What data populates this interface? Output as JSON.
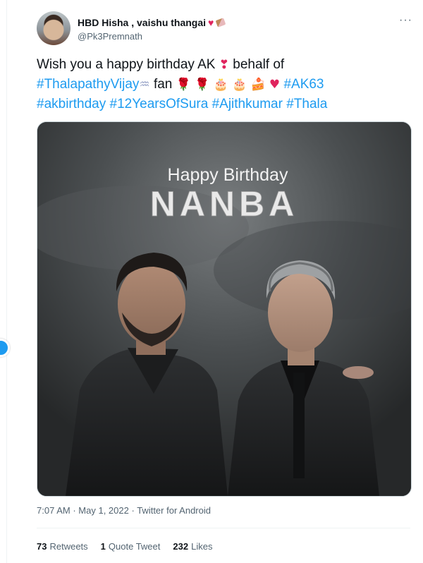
{
  "tweet": {
    "display_name": "HBD Hisha , vaishu thangai",
    "name_emoji": [
      "red-heart",
      "chocolate-bar"
    ],
    "handle": "@Pk3Premnath",
    "more_label": "···",
    "text": {
      "line1_a": "Wish you a happy birthday AK",
      "line1_b": "behalf of",
      "hashtag_vijay": "#ThalapathyVijay",
      "word_fan": "fan",
      "hashtag_ak63": "#AK63",
      "hashtag_akbirthday": "#akbirthday",
      "hashtag_12years": "#12YearsOfSura",
      "hashtag_ajith": "#Ajithkumar",
      "hashtag_thala": "#Thala"
    },
    "emoji": {
      "heavy_heart": "❣",
      "wave": "♒",
      "rose": "🌹",
      "cake": "🎂",
      "shortcake": "🍰",
      "red_heart": "♥"
    },
    "media": {
      "title_line1": "Happy Birthday",
      "title_line2": "NANBA"
    },
    "meta": {
      "time": "7:07 AM",
      "date": "May 1, 2022",
      "source": "Twitter for Android",
      "separator": "·"
    },
    "stats": {
      "retweets_count": "73",
      "retweets_label": "Retweets",
      "quotes_count": "1",
      "quotes_label": "Quote Tweet",
      "likes_count": "232",
      "likes_label": "Likes"
    }
  },
  "colors": {
    "link": "#1d9bf0",
    "text": "#0f1419",
    "secondary": "#536471",
    "heart": "#e0245e"
  }
}
